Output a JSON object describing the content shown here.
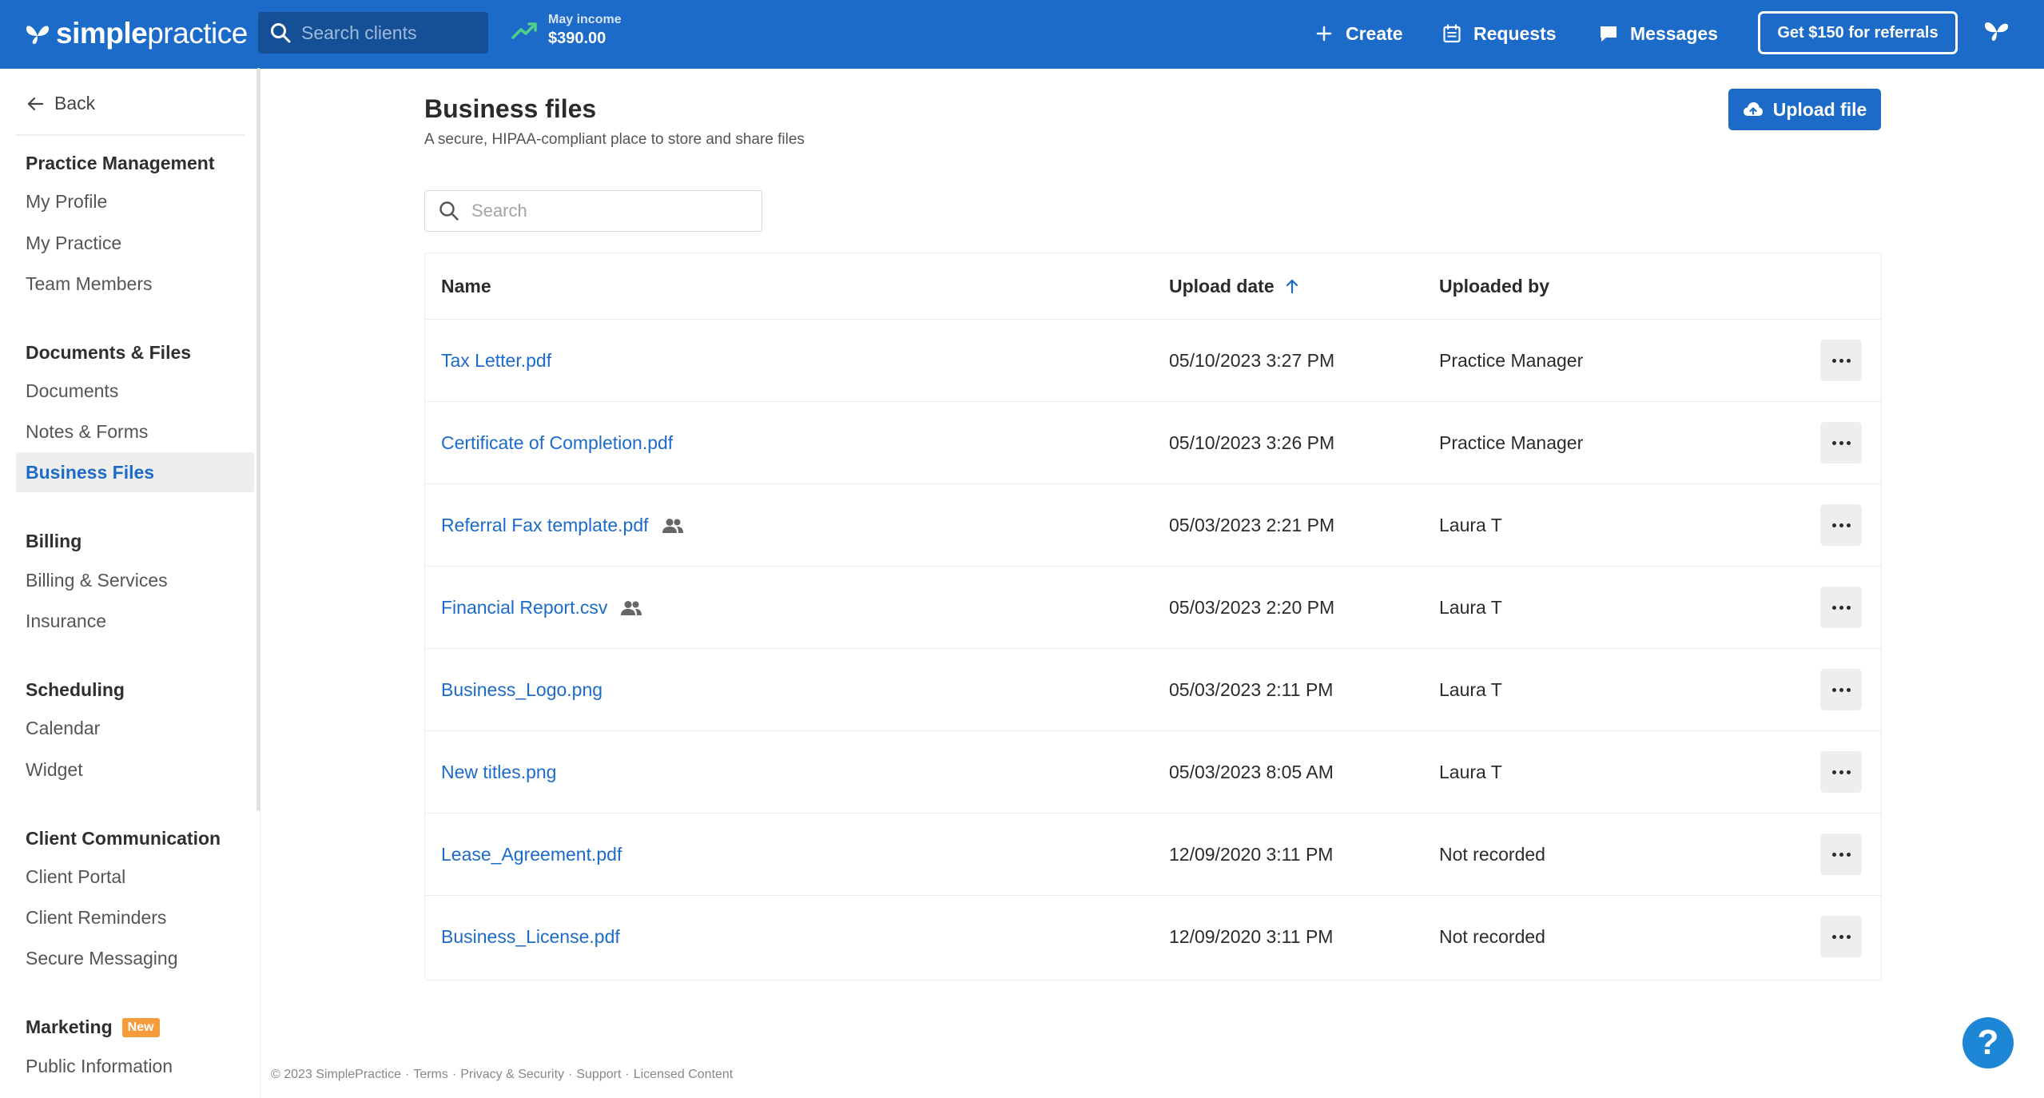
{
  "header": {
    "logo_bold": "simple",
    "logo_regular": "practice",
    "search_placeholder": "Search clients",
    "income_label": "May income",
    "income_value": "$390.00",
    "create_label": "Create",
    "requests_label": "Requests",
    "messages_label": "Messages",
    "referral_label": "Get $150 for referrals",
    "brand_color": "#1d6bc9"
  },
  "sidebar": {
    "back_label": "Back",
    "sections": [
      {
        "title": "Practice Management",
        "items": [
          "My Profile",
          "My Practice",
          "Team Members"
        ]
      },
      {
        "title": "Documents & Files",
        "items": [
          "Documents",
          "Notes & Forms",
          "Business Files"
        ]
      },
      {
        "title": "Billing",
        "items": [
          "Billing & Services",
          "Insurance"
        ]
      },
      {
        "title": "Scheduling",
        "items": [
          "Calendar",
          "Widget"
        ]
      },
      {
        "title": "Client Communication",
        "items": [
          "Client Portal",
          "Client Reminders",
          "Secure Messaging"
        ]
      },
      {
        "title": "Marketing",
        "badge": "New",
        "items": [
          "Public Information"
        ]
      }
    ],
    "active_item": "Business Files"
  },
  "main": {
    "title": "Business files",
    "subtitle": "A secure, HIPAA-compliant place to store and share files",
    "upload_label": "Upload file",
    "search_placeholder": "Search",
    "columns": {
      "name": "Name",
      "upload_date": "Upload date",
      "uploaded_by": "Uploaded by"
    },
    "sort": {
      "column": "Upload date",
      "direction": "ascending-arrow"
    },
    "files": [
      {
        "name": "Tax Letter.pdf",
        "date": "05/10/2023 3:27 PM",
        "by": "Practice Manager",
        "shared": false
      },
      {
        "name": "Certificate of Completion.pdf",
        "date": "05/10/2023 3:26 PM",
        "by": "Practice Manager",
        "shared": false
      },
      {
        "name": "Referral Fax template.pdf",
        "date": "05/03/2023 2:21 PM",
        "by": "Laura T",
        "shared": true
      },
      {
        "name": "Financial Report.csv",
        "date": "05/03/2023 2:20 PM",
        "by": "Laura T",
        "shared": true
      },
      {
        "name": "Business_Logo.png",
        "date": "05/03/2023 2:11 PM",
        "by": "Laura T",
        "shared": false
      },
      {
        "name": "New titles.png",
        "date": "05/03/2023 8:05 AM",
        "by": "Laura T",
        "shared": false
      },
      {
        "name": "Lease_Agreement.pdf",
        "date": "12/09/2020 3:11 PM",
        "by": "Not recorded",
        "shared": false
      },
      {
        "name": "Business_License.pdf",
        "date": "12/09/2020 3:11 PM",
        "by": "Not recorded",
        "shared": false
      }
    ]
  },
  "footer": {
    "copyright": "© 2023 SimplePractice",
    "links": [
      "Terms",
      "Privacy & Security",
      "Support",
      "Licensed Content"
    ]
  },
  "help_label": "?"
}
